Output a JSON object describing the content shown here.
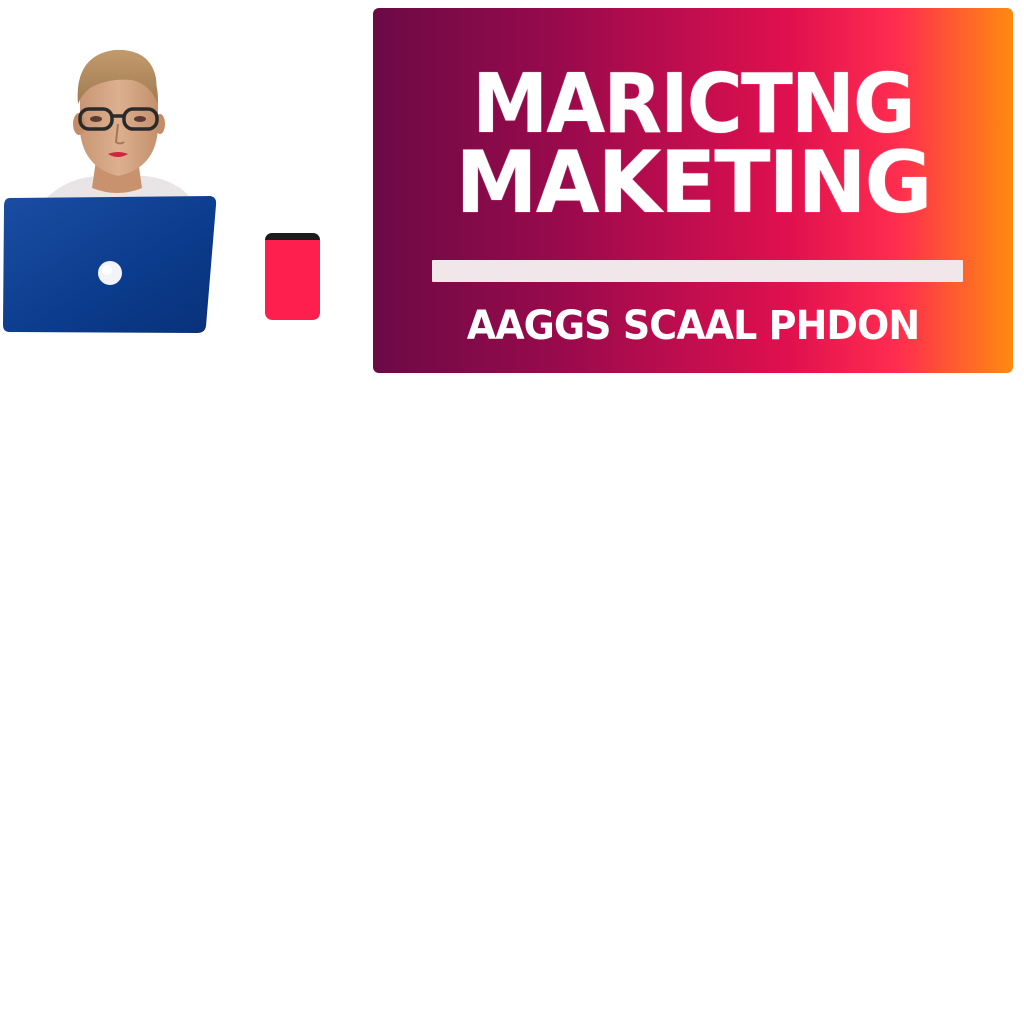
{
  "banner": {
    "title_line_1": "MARICTNG",
    "title_line_2": "MAKETING",
    "subtitle": "AAGGS SCAAL PHDON",
    "gradient_colors": [
      "#6b0a45",
      "#9a0a4c",
      "#e0104f",
      "#ff2d4f",
      "#ff8a10"
    ],
    "text_color": "#ffffff",
    "divider_color": "#f1e6ea"
  },
  "person": {
    "icon": "person-with-glasses-icon",
    "skin_color": "#d9a985",
    "hair_color": "#b48a5c",
    "glasses_color": "#2a2a2a"
  },
  "laptop": {
    "icon": "laptop-icon",
    "color": "#0c3d8f",
    "logo_color": "#ffffff"
  },
  "phone": {
    "icon": "phone-icon",
    "color": "#ff1f4e",
    "top_color": "#1c1c1c"
  }
}
